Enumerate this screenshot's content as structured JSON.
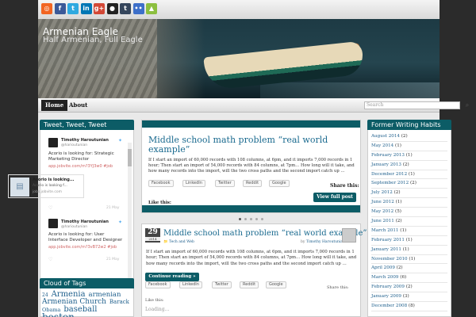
{
  "social_icons": [
    {
      "name": "rss-icon",
      "glyph": "◎",
      "color": "#f26522"
    },
    {
      "name": "facebook-icon",
      "glyph": "f",
      "color": "#3b5998"
    },
    {
      "name": "twitter-icon",
      "glyph": "t",
      "color": "#2fa9e0"
    },
    {
      "name": "linkedin-icon",
      "glyph": "in",
      "color": "#0077b5"
    },
    {
      "name": "googleplus-icon",
      "glyph": "g+",
      "color": "#d34836"
    },
    {
      "name": "github-icon",
      "glyph": "●",
      "color": "#222222"
    },
    {
      "name": "tumblr-icon",
      "glyph": "t",
      "color": "#35465c"
    },
    {
      "name": "flickr-icon",
      "glyph": "••",
      "color": "#3d6fc9"
    },
    {
      "name": "android-icon",
      "glyph": "▲",
      "color": "#8cbf3f"
    }
  ],
  "header": {
    "title": "Armenian Eagle",
    "tagline": "Half Armenian, Full Eagle"
  },
  "nav": {
    "home": "Home",
    "about": "About",
    "search_placeholder": "Search",
    "search_button": "⌕"
  },
  "twitter": {
    "title": "Tweet, Tweet, Tweet",
    "tweets": [
      {
        "name": "Timothy Haroutunian",
        "handle": "@harioutunian",
        "text": "Acorio is looking for: Strategic Marketing Director",
        "link": "app.jobvite.com/m?3YJ3w0 #job"
      },
      {
        "name": "Timothy Haroutunian",
        "handle": "@harioutunian",
        "text": "Acorio is looking for: User Interface Developer and Designer",
        "link": "app.jobvite.com/m?3vB72w2 #job"
      }
    ],
    "card": {
      "title": "Acorio is looking...",
      "desc": "Acorio is looking f...",
      "url": "jobs.jobvite.com"
    },
    "date1": "21 May",
    "date2": "21 May"
  },
  "tags": {
    "title": "Cloud of Tags",
    "items": [
      {
        "text": "24",
        "size": 6
      },
      {
        "text": "Armenia",
        "size": 10
      },
      {
        "text": "armenian",
        "size": 8.5
      },
      {
        "text": "Armenian Church",
        "size": 9
      },
      {
        "text": "Barack",
        "size": 7
      },
      {
        "text": "Obama",
        "size": 6.5
      },
      {
        "text": "baseball",
        "size": 10
      },
      {
        "text": "boston",
        "size": 12
      }
    ]
  },
  "slider": {
    "title": "Middle school math problem “real world example”",
    "body": "If I start an import of 60,000 records with 108 columns, at 6pm, and it imports 7,000 records in 1 hour; Then start an import of 54,000 records with 84 columns, at 7pm… How long will it take, and how many records into the import, will the two cross paths and the second import catch up …",
    "share_label": "Share this:",
    "share_buttons": [
      "Facebook",
      "LinkedIn",
      "Twitter",
      "Reddit",
      "Google"
    ],
    "view_button": "View full post",
    "like_label": "Like this:"
  },
  "post": {
    "day": "29",
    "year": "2014",
    "title": "Middle school math problem “real world example”",
    "category": "Tech and Web",
    "by_label": "by",
    "author": "Timothy Haroutunian",
    "body": "If I start an import of 60,000 records with 108 columns, at 6pm, and it imports 7,000 records in 1 hour; Then start an import of 54,000 records with 84 columns, at 7pm… How long will it take, and how many records into the import, will the two cross paths and the second import catch up …",
    "continue_button": "Continue reading »",
    "share_label": "Share this:",
    "share_buttons": [
      "Facebook",
      "LinkedIn",
      "Twitter",
      "Reddit",
      "Google"
    ],
    "like_label": "Like this:",
    "loading": "Loading..."
  },
  "archives": {
    "title": "Former Writing Habits",
    "items": [
      {
        "month": "August 2014",
        "count": "(2)"
      },
      {
        "month": "May 2014",
        "count": "(1)"
      },
      {
        "month": "February 2013",
        "count": "(1)"
      },
      {
        "month": "January 2013",
        "count": "(2)"
      },
      {
        "month": "December 2012",
        "count": "(1)"
      },
      {
        "month": "September 2012",
        "count": "(2)"
      },
      {
        "month": "July 2012",
        "count": "(2)"
      },
      {
        "month": "June 2012",
        "count": "(1)"
      },
      {
        "month": "May 2012",
        "count": "(5)"
      },
      {
        "month": "June 2011",
        "count": "(2)"
      },
      {
        "month": "March 2011",
        "count": "(1)"
      },
      {
        "month": "February 2011",
        "count": "(1)"
      },
      {
        "month": "January 2011",
        "count": "(1)"
      },
      {
        "month": "November 2010",
        "count": "(1)"
      },
      {
        "month": "April 2009",
        "count": "(2)"
      },
      {
        "month": "March 2009",
        "count": "(6)"
      },
      {
        "month": "February 2009",
        "count": "(2)"
      },
      {
        "month": "January 2009",
        "count": "(3)"
      },
      {
        "month": "December 2008",
        "count": "(8)"
      }
    ]
  }
}
